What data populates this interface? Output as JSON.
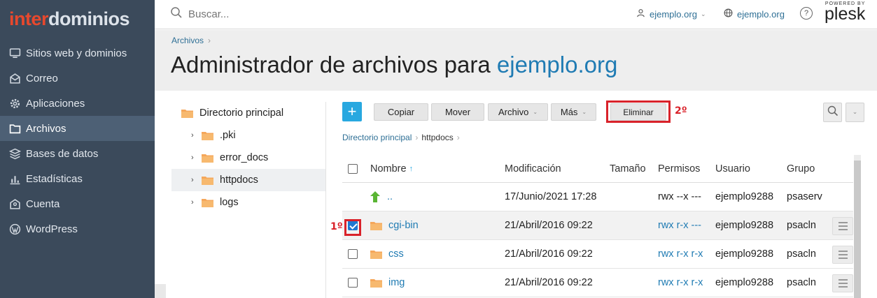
{
  "brand": {
    "logo_part1": "inter",
    "logo_part2": "dominios",
    "powered_by": "POWERED BY",
    "plesk": "plesk"
  },
  "colors": {
    "sidebar_bg": "#3b4a5b",
    "accent_blue": "#1f7bb3",
    "highlight_red": "#d9222a",
    "plus_button": "#28a8e0"
  },
  "sidebar": {
    "items": [
      {
        "label": "Sitios web y dominios",
        "icon": "monitor-icon"
      },
      {
        "label": "Correo",
        "icon": "mail-icon"
      },
      {
        "label": "Aplicaciones",
        "icon": "gear-icon"
      },
      {
        "label": "Archivos",
        "icon": "folder-icon",
        "active": true
      },
      {
        "label": "Bases de datos",
        "icon": "database-icon"
      },
      {
        "label": "Estadísticas",
        "icon": "bar-chart-icon"
      },
      {
        "label": "Cuenta",
        "icon": "account-icon"
      },
      {
        "label": "WordPress",
        "icon": "wordpress-icon"
      }
    ]
  },
  "topbar": {
    "search_placeholder": "Buscar...",
    "user": "ejemplo.org",
    "domain": "ejemplo.org",
    "help": "?"
  },
  "header": {
    "breadcrumb": "Archivos",
    "title_prefix": "Administrador de archivos para",
    "title_domain": "ejemplo.org"
  },
  "tree": {
    "root": "Directorio principal",
    "children": [
      ".pki",
      "error_docs",
      "httpdocs",
      "logs"
    ]
  },
  "toolbar": {
    "plus": "+",
    "copy": "Copiar",
    "move": "Mover",
    "file": "Archivo",
    "more": "Más",
    "delete": "Eliminar",
    "step2": "2º",
    "step1": "1º"
  },
  "path": {
    "root": "Directorio principal",
    "current": "httpdocs"
  },
  "table": {
    "headers": {
      "name": "Nombre",
      "modified": "Modificación",
      "size": "Tamaño",
      "perms": "Permisos",
      "user": "Usuario",
      "group": "Grupo"
    },
    "rows": [
      {
        "name": "..",
        "modified": "17/Junio/2021 17:28",
        "size": "",
        "perms": "rwx --x ---",
        "user": "ejemplo9288",
        "group": "psaserv"
      },
      {
        "name": "cgi-bin",
        "modified": "21/Abril/2016 09:22",
        "size": "",
        "perms": "rwx r-x ---",
        "user": "ejemplo9288",
        "group": "psacln"
      },
      {
        "name": "css",
        "modified": "21/Abril/2016 09:22",
        "size": "",
        "perms": "rwx r-x r-x",
        "user": "ejemplo9288",
        "group": "psacln"
      },
      {
        "name": "img",
        "modified": "21/Abril/2016 09:22",
        "size": "",
        "perms": "rwx r-x r-x",
        "user": "ejemplo9288",
        "group": "psacln"
      }
    ]
  }
}
